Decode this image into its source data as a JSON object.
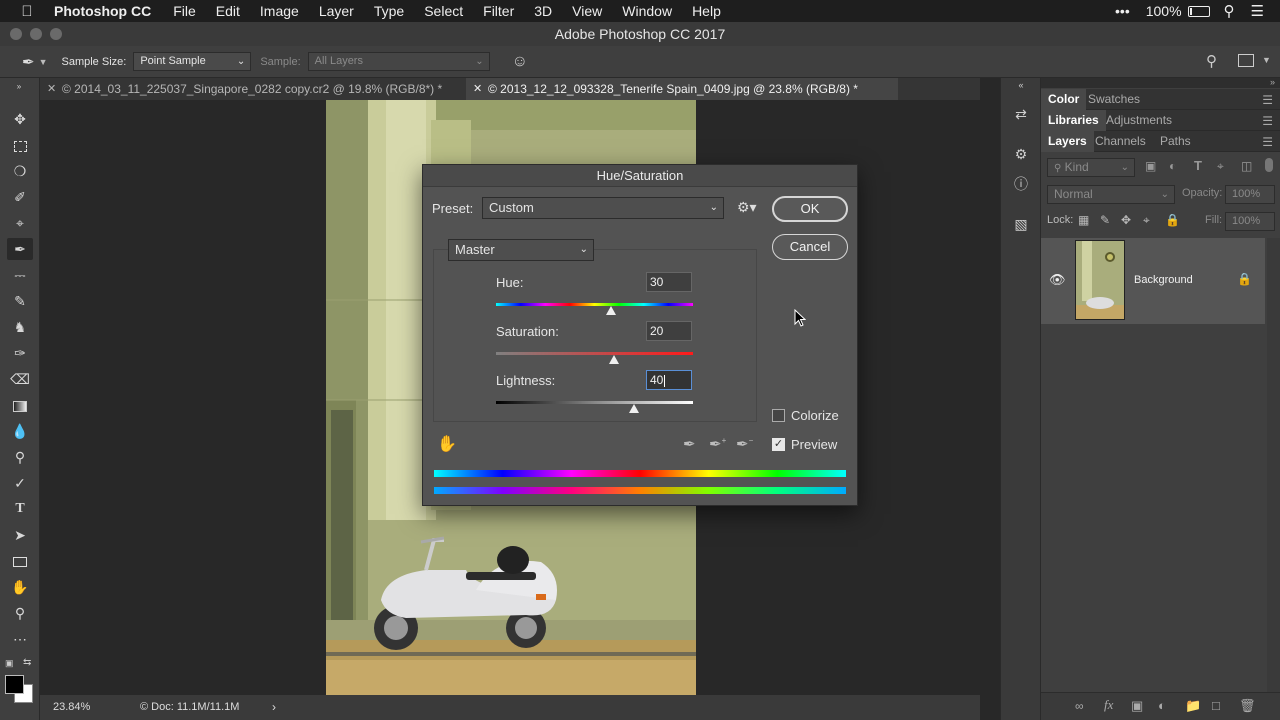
{
  "menubar": {
    "app": "Photoshop CC",
    "items": [
      "File",
      "Edit",
      "Image",
      "Layer",
      "Type",
      "Select",
      "Filter",
      "3D",
      "View",
      "Window",
      "Help"
    ],
    "dots": "•••",
    "battery": "100%"
  },
  "window": {
    "title": "Adobe Photoshop CC 2017"
  },
  "options": {
    "sample_size_label": "Sample Size:",
    "sample_size_value": "Point Sample",
    "sample_label": "Sample:",
    "sample_value": "All Layers"
  },
  "tabs": [
    {
      "label": "© 2014_03_11_225037_Singapore_0282 copy.cr2 @ 19.8% (RGB/8*) *"
    },
    {
      "label": "© 2013_12_12_093328_Tenerife Spain_0409.jpg @ 23.8% (RGB/8) *"
    }
  ],
  "status": {
    "zoom": "23.84%",
    "doc": "© Doc: 11.1M/11.1M"
  },
  "panels": {
    "row1": [
      "Color",
      "Swatches"
    ],
    "row2": [
      "Libraries",
      "Adjustments"
    ],
    "row3": [
      "Layers",
      "Channels",
      "Paths"
    ],
    "kind": "Kind",
    "blend": "Normal",
    "opacity_label": "Opacity:",
    "opacity_value": "100%",
    "lock_label": "Lock:",
    "fill_label": "Fill:",
    "fill_value": "100%",
    "layer_name": "Background"
  },
  "dialog": {
    "title": "Hue/Saturation",
    "preset_label": "Preset:",
    "preset_value": "Custom",
    "channel": "Master",
    "hue_label": "Hue:",
    "hue_value": "30",
    "sat_label": "Saturation:",
    "sat_value": "20",
    "light_label": "Lightness:",
    "light_value": "40",
    "ok": "OK",
    "cancel": "Cancel",
    "colorize": "Colorize",
    "preview": "Preview",
    "colorize_checked": false,
    "preview_checked": true,
    "hue_fraction": 0.583,
    "sat_fraction": 0.6,
    "light_fraction": 0.7
  }
}
